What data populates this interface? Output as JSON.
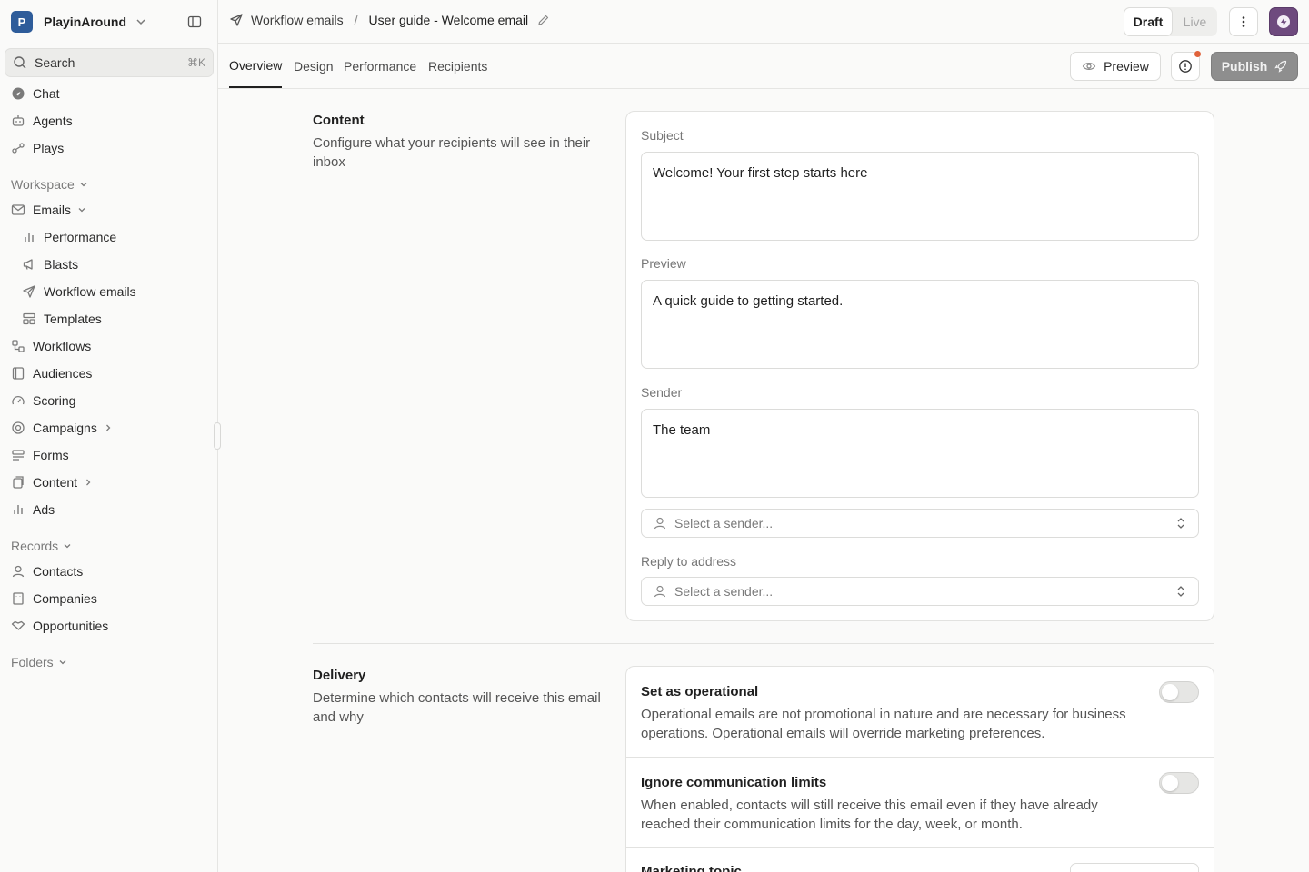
{
  "workspace": {
    "initial": "P",
    "name": "PlayinAround"
  },
  "search": {
    "label": "Search",
    "shortcut": "⌘K"
  },
  "nav": {
    "top": [
      {
        "label": "Chat",
        "icon": "chat-icon"
      },
      {
        "label": "Agents",
        "icon": "robot-icon"
      },
      {
        "label": "Plays",
        "icon": "plays-icon"
      }
    ],
    "workspace_label": "Workspace",
    "emails_label": "Emails",
    "emails_sub": [
      {
        "label": "Performance",
        "icon": "bar-chart-icon"
      },
      {
        "label": "Blasts",
        "icon": "megaphone-icon"
      },
      {
        "label": "Workflow emails",
        "icon": "send-icon"
      },
      {
        "label": "Templates",
        "icon": "template-icon"
      }
    ],
    "workspace_items": [
      {
        "label": "Workflows",
        "icon": "workflow-icon"
      },
      {
        "label": "Audiences",
        "icon": "audience-icon"
      },
      {
        "label": "Scoring",
        "icon": "gauge-icon"
      },
      {
        "label": "Campaigns",
        "icon": "campaign-icon"
      },
      {
        "label": "Forms",
        "icon": "form-icon"
      },
      {
        "label": "Content",
        "icon": "content-icon"
      },
      {
        "label": "Ads",
        "icon": "bar-chart-icon"
      }
    ],
    "records_label": "Records",
    "records_items": [
      {
        "label": "Contacts",
        "icon": "user-icon"
      },
      {
        "label": "Companies",
        "icon": "building-icon"
      },
      {
        "label": "Opportunities",
        "icon": "handshake-icon"
      }
    ],
    "folders_label": "Folders"
  },
  "breadcrumb": {
    "parent": "Workflow emails",
    "separator": "/",
    "current": "User guide - Welcome email"
  },
  "status": {
    "draft": "Draft",
    "live": "Live"
  },
  "tabs": [
    "Overview",
    "Design",
    "Performance",
    "Recipients"
  ],
  "actions": {
    "preview": "Preview",
    "publish": "Publish"
  },
  "content_section": {
    "title": "Content",
    "description": "Configure what your recipients will see in their inbox",
    "subject_label": "Subject",
    "subject_value": "Welcome! Your first step starts here",
    "preview_label": "Preview",
    "preview_value": "A quick guide to getting started.",
    "sender_label": "Sender",
    "sender_value": "The team",
    "sender_select_placeholder": "Select a sender...",
    "reply_label": "Reply to address",
    "reply_select_placeholder": "Select a sender..."
  },
  "delivery_section": {
    "title": "Delivery",
    "description": "Determine which contacts will receive this email and why",
    "options": [
      {
        "title": "Set as operational",
        "description": "Operational emails are not promotional in nature and are necessary for business operations. Operational emails will override marketing preferences.",
        "enabled": false
      },
      {
        "title": "Ignore communication limits",
        "description": "When enabled, contacts will still receive this email even if they have already reached their communication limits for the day, week, or month.",
        "enabled": false
      }
    ],
    "partial_title": "Marketing topic"
  },
  "colors": {
    "brand": "#2e5c9a",
    "assistant": "#6e4a7e",
    "notification": "#e0623a",
    "publish": "#8e8e8e"
  }
}
